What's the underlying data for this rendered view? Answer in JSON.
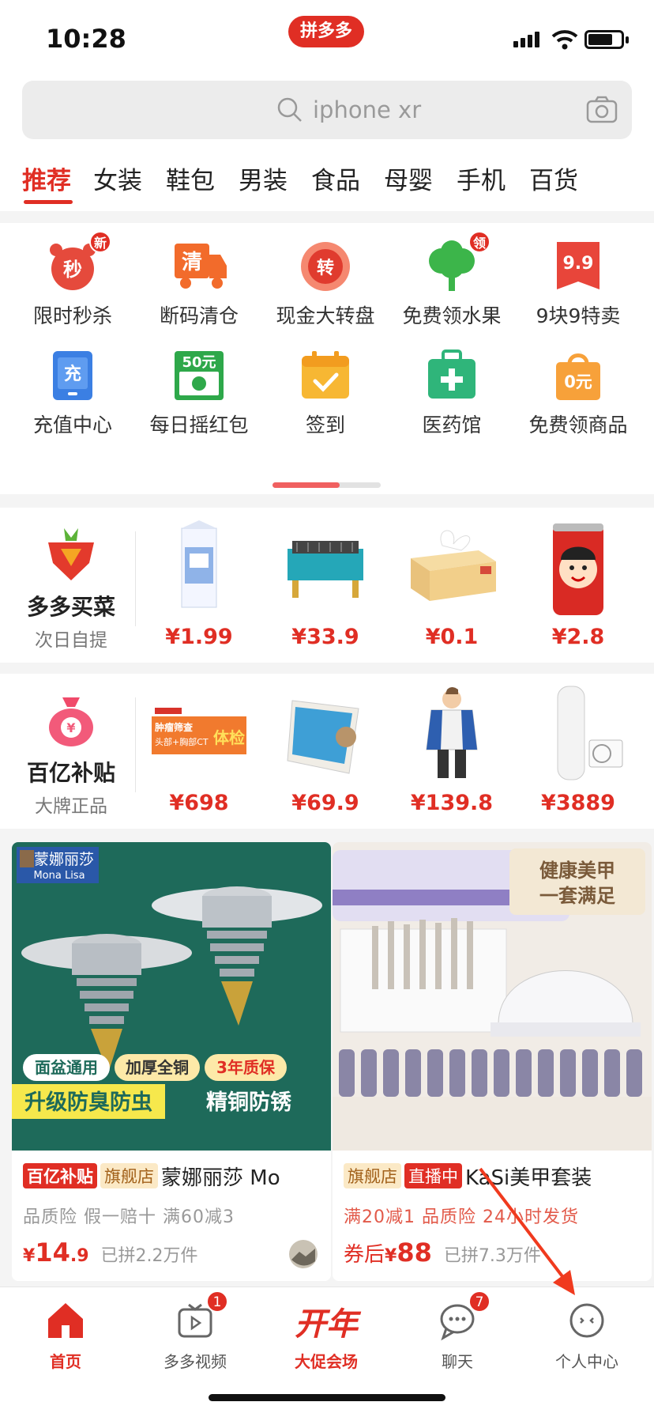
{
  "status_bar": {
    "time": "10:28",
    "app_badge": "拼多多"
  },
  "search": {
    "placeholder": "iphone xr"
  },
  "tabs": [
    {
      "label": "推荐",
      "active": true
    },
    {
      "label": "女装"
    },
    {
      "label": "鞋包"
    },
    {
      "label": "男装"
    },
    {
      "label": "食品"
    },
    {
      "label": "母婴"
    },
    {
      "label": "手机"
    },
    {
      "label": "百货"
    }
  ],
  "grid": {
    "row1": [
      {
        "label": "限时秒杀",
        "icon": "alarm-clock-icon",
        "glyph": "秒",
        "badge": "新"
      },
      {
        "label": "断码清仓",
        "icon": "truck-icon",
        "glyph": "清"
      },
      {
        "label": "现金大转盘",
        "icon": "wheel-icon",
        "glyph": "转"
      },
      {
        "label": "免费领水果",
        "icon": "tree-icon",
        "badge": "领"
      },
      {
        "label": "9块9特卖",
        "icon": "ribbon-icon",
        "glyph": "9.9"
      }
    ],
    "row2": [
      {
        "label": "充值中心",
        "icon": "phone-charge-icon",
        "glyph": "充"
      },
      {
        "label": "每日摇红包",
        "icon": "red-packet-icon",
        "glyph": "50元"
      },
      {
        "label": "签到",
        "icon": "calendar-check-icon"
      },
      {
        "label": "医药馆",
        "icon": "medical-kit-icon"
      },
      {
        "label": "免费领商品",
        "icon": "shopping-bag-icon",
        "glyph": "0元"
      }
    ]
  },
  "row_groceries": {
    "title": "多多买菜",
    "subtitle": "次日自提",
    "items": [
      {
        "price": "¥1.99",
        "icon": "milk-carton-image"
      },
      {
        "price": "¥33.9",
        "icon": "grill-image"
      },
      {
        "price": "¥0.1",
        "icon": "tissue-box-image"
      },
      {
        "price": "¥2.8",
        "icon": "drink-can-image"
      }
    ]
  },
  "row_subsidy": {
    "title": "百亿补贴",
    "subtitle": "大牌正品",
    "items": [
      {
        "price": "¥698",
        "icon": "health-check-card-image",
        "lines": [
          "肿瘤筛查",
          "头部+胸部CT"
        ],
        "stamp": "体检"
      },
      {
        "price": "¥69.9",
        "icon": "window-cleaner-image"
      },
      {
        "price": "¥139.8",
        "icon": "kids-jacket-image"
      },
      {
        "price": "¥3889",
        "icon": "water-heater-image"
      }
    ]
  },
  "feed": [
    {
      "brand_logo": "蒙娜丽莎",
      "brand_logo_en": "Mona  Lisa",
      "chips": [
        "面盆通用",
        "加厚全铜",
        "3年质保"
      ],
      "banner_left": "升级防臭防虫",
      "banner_right": "精铜防锈",
      "tags": [
        "百亿补贴",
        "旗舰店"
      ],
      "title": "蒙娜丽莎 Mo",
      "services": "品质险  假一赔十  满60减3",
      "price_symbol": "¥",
      "price_int": "14",
      "price_dec": ".9",
      "sold": "已拼2.2万件"
    },
    {
      "corner_text_1": "健康美甲",
      "corner_text_2": "一套满足",
      "tags": [
        "旗舰店",
        "直播中"
      ],
      "title": "KaSi美甲套装",
      "services": "满20减1  品质险  24小时发货",
      "price_prefix": "券后",
      "price_symbol": "¥",
      "price_int": "88",
      "sold": "已拼7.3万件"
    }
  ],
  "bottom_nav": [
    {
      "label": "首页",
      "icon": "home-icon",
      "active": true
    },
    {
      "label": "多多视频",
      "icon": "video-icon",
      "badge": "1"
    },
    {
      "label": "大促会场",
      "icon": "promo-icon",
      "glyph": "开年"
    },
    {
      "label": "聊天",
      "icon": "chat-icon",
      "badge": "7"
    },
    {
      "label": "个人中心",
      "icon": "profile-icon"
    }
  ],
  "colors": {
    "accent": "#e02e24",
    "bg": "#f4f4f4",
    "annotation": "#f03a1e"
  }
}
